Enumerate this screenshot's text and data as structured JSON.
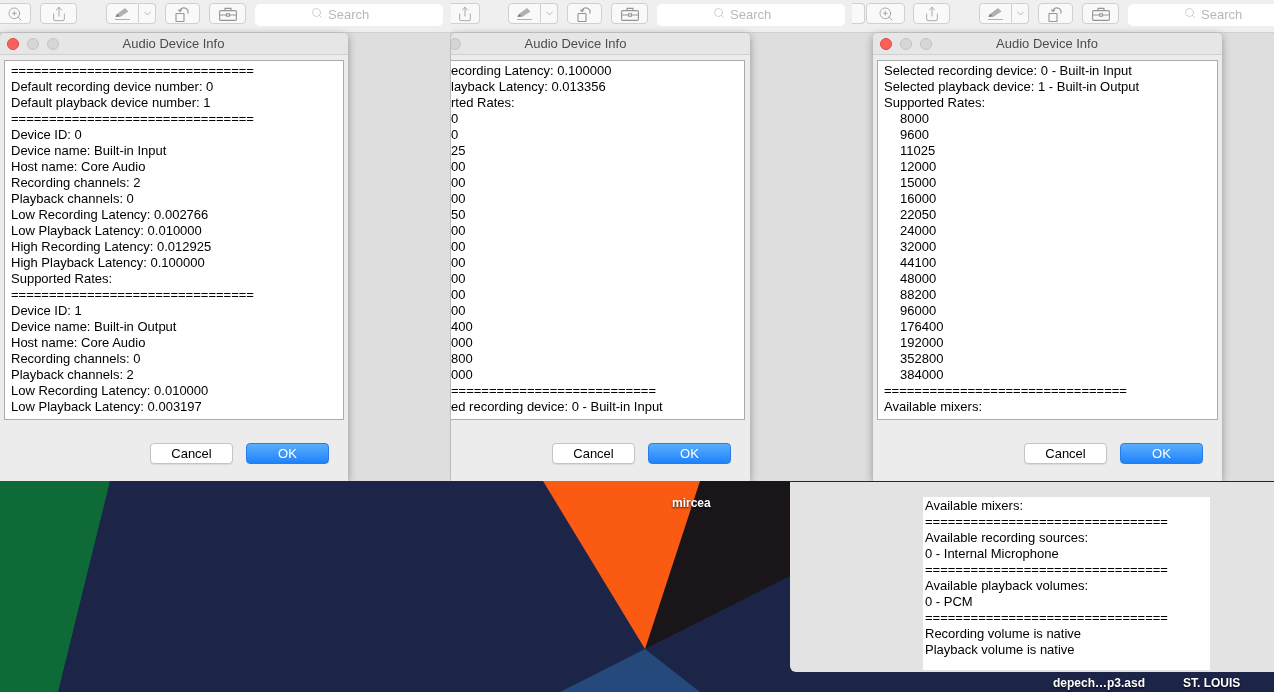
{
  "panels": [
    {
      "toolbar": {
        "search": {
          "placeholder": "Search"
        }
      },
      "dialog": {
        "title": "Audio Device Info",
        "lines": [
          {
            "kind": "text",
            "text": "================================"
          },
          {
            "kind": "text",
            "text": "Default recording device number: 0"
          },
          {
            "kind": "text",
            "text": "Default playback device number: 1"
          },
          {
            "kind": "text",
            "text": "================================"
          },
          {
            "kind": "text",
            "text": "Device ID: 0"
          },
          {
            "kind": "text",
            "text": "Device name: Built-in Input"
          },
          {
            "kind": "text",
            "text": "Host name: Core Audio"
          },
          {
            "kind": "text",
            "text": "Recording channels: 2"
          },
          {
            "kind": "text",
            "text": "Playback channels: 0"
          },
          {
            "kind": "text",
            "text": "Low Recording Latency: 0.002766"
          },
          {
            "kind": "text",
            "text": "Low Playback Latency: 0.010000"
          },
          {
            "kind": "text",
            "text": "High Recording Latency: 0.012925"
          },
          {
            "kind": "text",
            "text": "High Playback Latency: 0.100000"
          },
          {
            "kind": "text",
            "text": "Supported Rates:"
          },
          {
            "kind": "text",
            "text": "================================"
          },
          {
            "kind": "text",
            "text": "Device ID: 1"
          },
          {
            "kind": "text",
            "text": "Device name: Built-in Output"
          },
          {
            "kind": "text",
            "text": "Host name: Core Audio"
          },
          {
            "kind": "text",
            "text": "Recording channels: 0"
          },
          {
            "kind": "text",
            "text": "Playback channels: 2"
          },
          {
            "kind": "text",
            "text": "Low Recording Latency: 0.010000"
          },
          {
            "kind": "text",
            "text": "Low Playback Latency: 0.003197"
          }
        ],
        "buttons": [
          {
            "kind": "cancel",
            "label": "Cancel"
          },
          {
            "kind": "default",
            "label": "OK"
          }
        ]
      }
    },
    {
      "toolbar": {
        "search": {
          "placeholder": "Search"
        }
      },
      "dialog": {
        "title": "Audio Device Info",
        "lines": [
          {
            "kind": "text",
            "text": "ecording Latency: 0.100000"
          },
          {
            "kind": "text",
            "text": "layback Latency: 0.013356"
          },
          {
            "kind": "text",
            "text": "rted Rates:"
          },
          {
            "kind": "text",
            "text": "0"
          },
          {
            "kind": "text",
            "text": "0"
          },
          {
            "kind": "text",
            "text": "25"
          },
          {
            "kind": "text",
            "text": "00"
          },
          {
            "kind": "text",
            "text": "00"
          },
          {
            "kind": "text",
            "text": "00"
          },
          {
            "kind": "text",
            "text": "50"
          },
          {
            "kind": "text",
            "text": "00"
          },
          {
            "kind": "text",
            "text": "00"
          },
          {
            "kind": "text",
            "text": "00"
          },
          {
            "kind": "text",
            "text": "00"
          },
          {
            "kind": "text",
            "text": "00"
          },
          {
            "kind": "text",
            "text": "00"
          },
          {
            "kind": "text",
            "text": "400"
          },
          {
            "kind": "text",
            "text": "000"
          },
          {
            "kind": "text",
            "text": "800"
          },
          {
            "kind": "text",
            "text": "000"
          },
          {
            "kind": "text",
            "text": "==========================="
          },
          {
            "kind": "text",
            "text": "ed recording device: 0 - Built-in Input"
          }
        ],
        "buttons": [
          {
            "kind": "cancel",
            "label": "Cancel"
          },
          {
            "kind": "default",
            "label": "OK"
          }
        ]
      }
    },
    {
      "toolbar": {
        "search": {
          "placeholder": "Search"
        }
      },
      "dialog": {
        "title": "Audio Device Info",
        "lines": [
          {
            "kind": "text",
            "text": "Selected recording device: 0 - Built-in Input"
          },
          {
            "kind": "text",
            "text": "Selected playback device: 1 - Built-in Output"
          },
          {
            "kind": "text",
            "text": "Supported Rates:"
          },
          {
            "kind": "rate",
            "text": "8000"
          },
          {
            "kind": "rate",
            "text": "9600"
          },
          {
            "kind": "rate",
            "text": "11025"
          },
          {
            "kind": "rate",
            "text": "12000"
          },
          {
            "kind": "rate",
            "text": "15000"
          },
          {
            "kind": "rate",
            "text": "16000"
          },
          {
            "kind": "rate",
            "text": "22050"
          },
          {
            "kind": "rate",
            "text": "24000"
          },
          {
            "kind": "rate",
            "text": "32000"
          },
          {
            "kind": "rate",
            "text": "44100"
          },
          {
            "kind": "rate",
            "text": "48000"
          },
          {
            "kind": "rate",
            "text": "88200"
          },
          {
            "kind": "rate",
            "text": "96000"
          },
          {
            "kind": "rate",
            "text": "176400"
          },
          {
            "kind": "rate",
            "text": "192000"
          },
          {
            "kind": "rate",
            "text": "352800"
          },
          {
            "kind": "rate",
            "text": "384000"
          },
          {
            "kind": "text",
            "text": "================================"
          },
          {
            "kind": "text",
            "text": "Available mixers:"
          }
        ],
        "buttons": [
          {
            "kind": "cancel",
            "label": "Cancel"
          },
          {
            "kind": "default",
            "label": "OK"
          }
        ]
      }
    }
  ],
  "mixer_panel": {
    "lines": [
      "Available mixers:",
      "================================",
      "Available recording sources:",
      "0 - Internal Microphone",
      "================================",
      "Available playback volumes:",
      "0 - PCM",
      "================================",
      "Recording volume is native",
      "Playback volume is native"
    ]
  },
  "desktop": {
    "icon_labels": [
      "mircea",
      "depech…p3.asd",
      "ST. LOUIS"
    ]
  }
}
